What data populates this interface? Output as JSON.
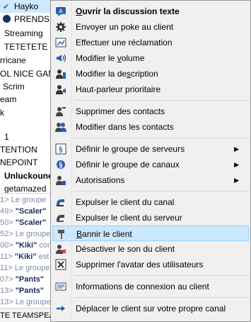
{
  "tree": {
    "title": "Hayko",
    "rows": [
      {
        "text": "PRENDS",
        "kind": "dot"
      },
      {
        "text": "Streaming"
      },
      {
        "text": "TETETETE"
      },
      {
        "text": "rricane"
      },
      {
        "text": "OL NICE GAM"
      },
      {
        "text": "Scrim"
      },
      {
        "text": "eam"
      },
      {
        "text": "k"
      },
      {
        "text": "1"
      },
      {
        "text": "TENTION"
      },
      {
        "text": "NEPOINT"
      },
      {
        "text": "Unluckoune",
        "bold": true
      },
      {
        "text": "getamazed"
      }
    ]
  },
  "chat": {
    "lines": [
      {
        "prefix": "1> Le groupe",
        "nick": "",
        "rest": ""
      },
      {
        "prefix": "49> ",
        "nick": "\"Scaler\"",
        "rest": ""
      },
      {
        "prefix": "50> ",
        "nick": "\"Scaler\"",
        "rest": ""
      },
      {
        "prefix": "52> Le groupe",
        "nick": "",
        "rest": ""
      },
      {
        "prefix": "00> ",
        "nick": "\"Kiki\"",
        "rest": " con"
      },
      {
        "prefix": "11> ",
        "nick": "\"Kiki\"",
        "rest": " est"
      },
      {
        "prefix": "11> Le groupe",
        "nick": "",
        "rest": ""
      },
      {
        "prefix": "07> ",
        "nick": "\"Pants\"",
        "rest": ""
      },
      {
        "prefix": "13> ",
        "nick": "\"Pants\"",
        "rest": ""
      },
      {
        "prefix": "13> Le groupe",
        "nick": "",
        "rest": ""
      }
    ],
    "status": "TE TEAMSPEAK"
  },
  "menu": {
    "items": [
      {
        "label": "Ouvrir la discussion texte",
        "u": "O",
        "icon": "chat-bubble-icon",
        "bold": true
      },
      {
        "label": "Envoyer un poke au client",
        "icon": "poke-gear-icon"
      },
      {
        "label": "Effectuer une réclamation",
        "icon": "complaint-icon"
      },
      {
        "label": "Modifier le volume",
        "u": "v",
        "icon": "speaker-volume-icon"
      },
      {
        "label": "Modifier la description",
        "u": "s",
        "icon": "user-edit-icon"
      },
      {
        "label": "Haut-parleur prioritaire",
        "icon": "priority-speaker-icon"
      },
      {
        "sep": true
      },
      {
        "label": "Supprimer des contacts",
        "icon": "contact-remove-icon"
      },
      {
        "label": "Modifier dans les contacts",
        "icon": "contact-edit-icon"
      },
      {
        "sep": true
      },
      {
        "label": "Définir le groupe de serveurs",
        "icon": "server-group-icon",
        "submenu": true
      },
      {
        "label": "Définir le groupe de canaux",
        "icon": "channel-group-icon",
        "submenu": true
      },
      {
        "label": "Autorisations",
        "icon": "permissions-icon",
        "submenu": true
      },
      {
        "sep": true
      },
      {
        "label": "Expulser le client du canal",
        "icon": "kick-channel-icon"
      },
      {
        "label": "Expulser le client du serveur",
        "icon": "kick-server-icon"
      },
      {
        "label": "Bannir le client",
        "u": "B",
        "icon": "ban-hammer-icon",
        "highlight": true
      },
      {
        "label": "Désactiver le son du client",
        "icon": "mute-client-icon"
      },
      {
        "label": "Supprimer l'avatar des utilisateurs",
        "icon": "delete-avatar-icon"
      },
      {
        "sep": true
      },
      {
        "label": "Informations de connexion au client",
        "icon": "connection-info-icon"
      },
      {
        "sep": true
      },
      {
        "label": "Déplacer le client sur votre propre canal",
        "icon": "move-client-icon"
      }
    ]
  },
  "colors": {
    "menu_bg": "#f0f0f0",
    "highlight_bg": "#cce8ff",
    "highlight_border": "#99d1ff",
    "icon_blue": "#2b5ea8",
    "nick_color": "#1a2a5e"
  }
}
